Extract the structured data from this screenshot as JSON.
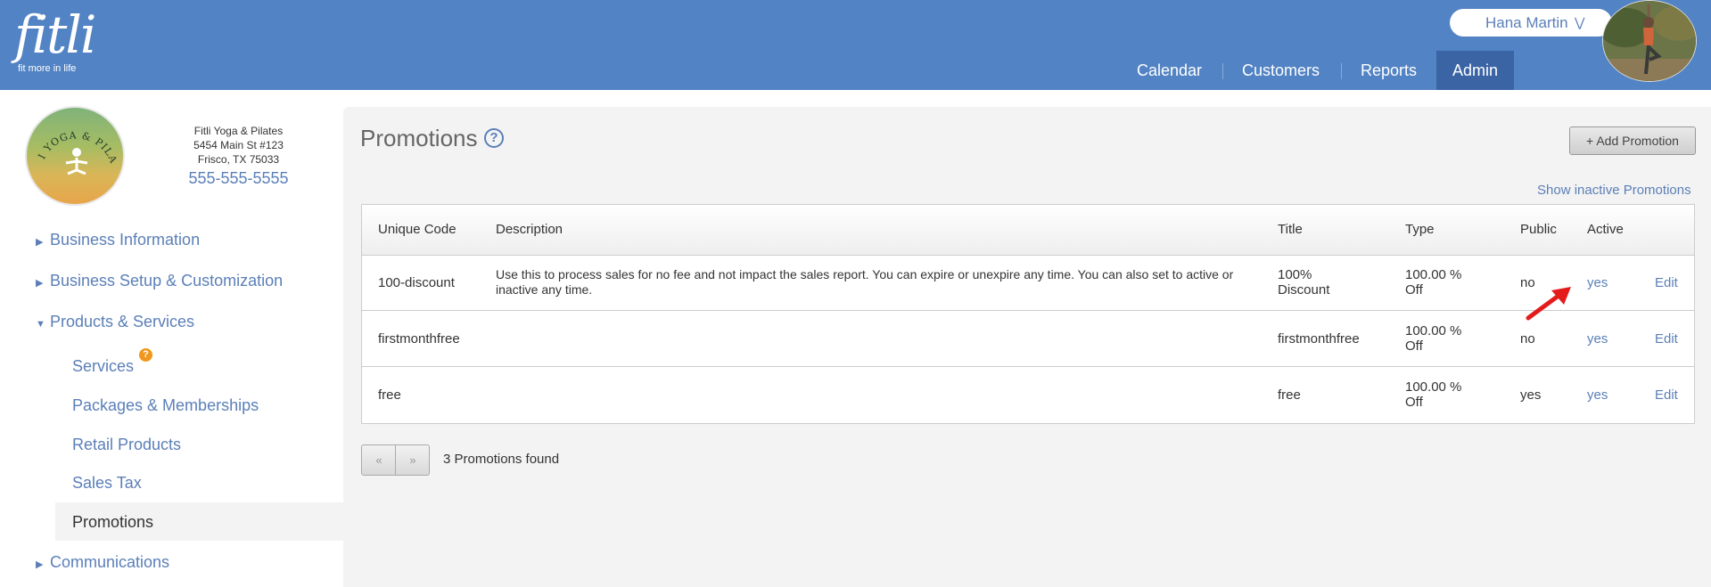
{
  "brand": {
    "name": "fitli",
    "tagline": "fit more in life"
  },
  "user": {
    "name": "Hana Martin",
    "chevron_icon": "double-chevron-down-icon"
  },
  "topnav": {
    "items": [
      {
        "label": "Calendar"
      },
      {
        "label": "Customers"
      },
      {
        "label": "Reports"
      },
      {
        "label": "Admin",
        "active": true
      }
    ]
  },
  "business": {
    "name": "Fitli Yoga & Pilates",
    "address1": "5454 Main St #123",
    "address2": "Frisco, TX 75033",
    "phone": "555-555-5555",
    "logo_text": "FITLI YOGA & PILATES"
  },
  "sidebar": {
    "groups": [
      {
        "label": "Business Information",
        "expanded": false
      },
      {
        "label": "Business Setup & Customization",
        "expanded": false
      },
      {
        "label": "Products & Services",
        "expanded": true
      },
      {
        "label": "Communications",
        "expanded": false
      }
    ],
    "sub_items": [
      {
        "label": "Services",
        "badge": "?"
      },
      {
        "label": "Packages & Memberships"
      },
      {
        "label": "Retail Products"
      },
      {
        "label": "Sales Tax"
      },
      {
        "label": "Promotions",
        "active": true
      }
    ]
  },
  "main": {
    "title": "Promotions",
    "help_icon": "?",
    "add_button": "+ Add Promotion",
    "show_inactive": "Show inactive Promotions",
    "table": {
      "headers": [
        "Unique Code",
        "Description",
        "Title",
        "Type",
        "Public",
        "Active"
      ],
      "rows": [
        {
          "code": "100-discount",
          "description": "Use this to process sales for no fee and not impact the sales report. You can expire or unexpire any time. You can also set to active or inactive any time.",
          "title": "100% Discount",
          "type": "100.00 % Off",
          "public": "no",
          "active": "yes",
          "edit": "Edit"
        },
        {
          "code": "firstmonthfree",
          "description": "",
          "title": "firstmonthfree",
          "type": "100.00 % Off",
          "public": "no",
          "active": "yes",
          "edit": "Edit"
        },
        {
          "code": "free",
          "description": "",
          "title": "free",
          "type": "100.00 % Off",
          "public": "yes",
          "active": "yes",
          "edit": "Edit"
        }
      ]
    },
    "pager": {
      "prev": "«",
      "next": "»"
    },
    "found_text": "3 Promotions found"
  },
  "colors": {
    "header": "#5283c4",
    "link": "#5b7fb8",
    "active_tab": "#3b64a5",
    "badge": "#f0971c",
    "annotation_arrow": "#e31b1b"
  }
}
